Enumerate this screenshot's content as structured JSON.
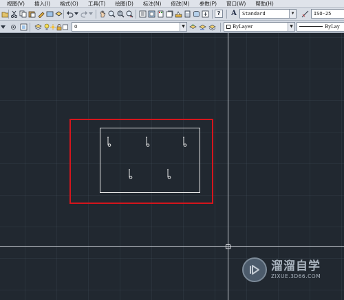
{
  "menubar": {
    "items": [
      "视图(V)",
      "插入(I)",
      "格式(O)",
      "工具(T)",
      "绘图(D)",
      "标注(N)",
      "修改(M)",
      "参数(P)",
      "窗口(W)",
      "帮助(H)"
    ]
  },
  "toolbar1": {
    "text_style_value": "Standard",
    "dim_style_value": "ISO-25",
    "text_style_icon": "A",
    "dim_style_icon": "dimension-style-icon",
    "help_icon": "?"
  },
  "toolbar2": {
    "layer_value": "0",
    "color_value": "ByLayer",
    "linetype_value": "ByLay"
  },
  "colors": {
    "canvas": "#212830",
    "highlight": "#d5151c",
    "geometry": "#e8e8e8",
    "crosshair": "#c8ccd2"
  },
  "watermark": {
    "title": "溜溜自学",
    "url": "ZIXUE.3D66.COM"
  }
}
